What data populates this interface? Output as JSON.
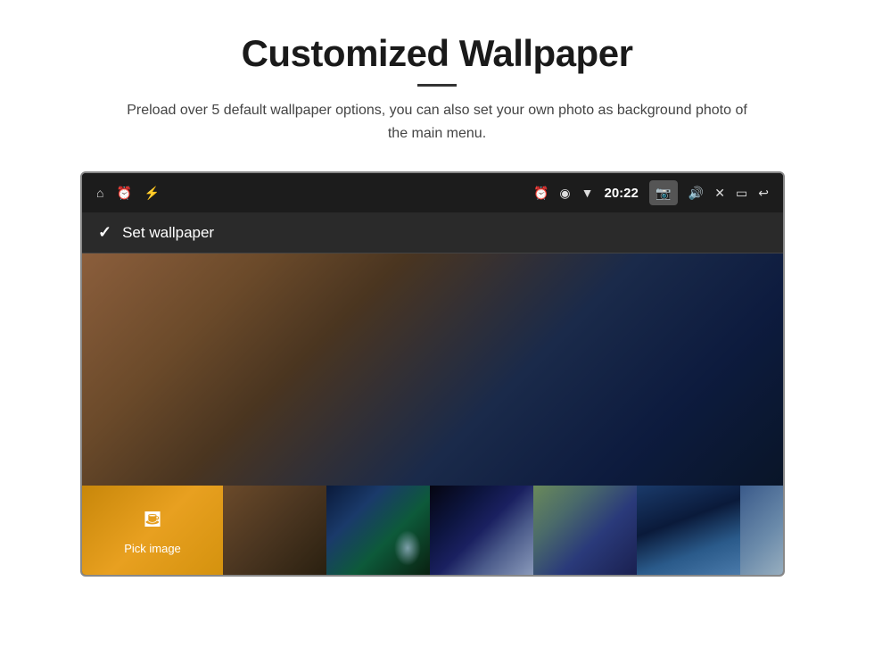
{
  "header": {
    "title": "Customized Wallpaper",
    "subtitle": "Preload over 5 default wallpaper options, you can also set your own photo as background photo of the main menu."
  },
  "status_bar": {
    "time": "20:22",
    "icons": {
      "home": "⌂",
      "alarm": "⏰",
      "usb": "⚡",
      "location": "◉",
      "wifi": "▼",
      "camera": "📷",
      "volume": "🔊",
      "close": "✕",
      "window": "▭",
      "back": "↩"
    }
  },
  "app_bar": {
    "title": "Set wallpaper"
  },
  "thumbnails": [
    {
      "id": "pick",
      "label": "Pick image"
    },
    {
      "id": "thumb-brown"
    },
    {
      "id": "thumb-aurora"
    },
    {
      "id": "thumb-space"
    },
    {
      "id": "thumb-swirl"
    },
    {
      "id": "thumb-ocean"
    },
    {
      "id": "thumb-light"
    }
  ]
}
